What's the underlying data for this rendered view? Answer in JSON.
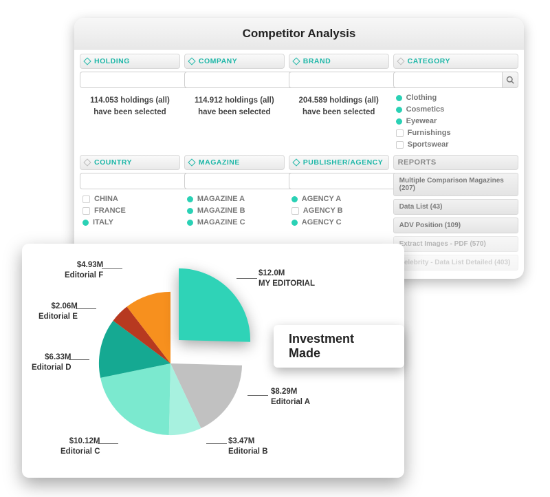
{
  "panel": {
    "title": "Competitor Analysis",
    "filters": {
      "holding": {
        "label": "HOLDING",
        "status_line1": "114.053 holdings (all)",
        "status_line2": "have been selected"
      },
      "company": {
        "label": "COMPANY",
        "status_line1": "114.912 holdings (all)",
        "status_line2": "have been selected"
      },
      "brand": {
        "label": "BRAND",
        "status_line1": "204.589 holdings (all)",
        "status_line2": "have been selected"
      },
      "category": {
        "label": "CATEGORY"
      },
      "country": {
        "label": "COUNTRY"
      },
      "magazine": {
        "label": "MAGAZINE"
      },
      "publisher": {
        "label": "PUBLISHER/AGENCY"
      },
      "reports": {
        "label": "REPORTS"
      }
    },
    "category_items": [
      {
        "label": "Clothing",
        "selected": true
      },
      {
        "label": "Cosmetics",
        "selected": true
      },
      {
        "label": "Eyewear",
        "selected": true
      },
      {
        "label": "Furnishings",
        "selected": false
      },
      {
        "label": "Sportswear",
        "selected": false
      }
    ],
    "country_items": [
      {
        "label": "CHINA",
        "selected": false
      },
      {
        "label": "FRANCE",
        "selected": false
      },
      {
        "label": "ITALY",
        "selected": true
      }
    ],
    "magazine_items": [
      {
        "label": "MAGAZINE A",
        "selected": true
      },
      {
        "label": "MAGAZINE B",
        "selected": true
      },
      {
        "label": "MAGAZINE C",
        "selected": true
      }
    ],
    "publisher_items": [
      {
        "label": "AGENCY A",
        "selected": true
      },
      {
        "label": "AGENCY B",
        "selected": false
      },
      {
        "label": "AGENCY C",
        "selected": true
      }
    ],
    "reports": [
      {
        "label": "Multiple Comparison Magazines (207)"
      },
      {
        "label": "Data List (43)"
      },
      {
        "label": "ADV Position (109)"
      },
      {
        "label": "Extract Images - PDF (570)"
      },
      {
        "label": "Celebrity - Data List Detailed (403)"
      }
    ]
  },
  "card": {
    "chip": "Investment Made"
  },
  "chart_data": {
    "type": "pie",
    "title": "Investment Made",
    "series": [
      {
        "name": "MY EDITORIAL",
        "value": 12.0,
        "label": "$12.0M",
        "color": "#2fd3b7",
        "raised": true
      },
      {
        "name": "Editorial A",
        "value": 8.29,
        "label": "$8.29M",
        "color": "#c1c1c1"
      },
      {
        "name": "Editorial B",
        "value": 3.47,
        "label": "$3.47M",
        "color": "#a7f1df"
      },
      {
        "name": "Editorial C",
        "value": 10.12,
        "label": "$10.12M",
        "color": "#7be9cf"
      },
      {
        "name": "Editorial D",
        "value": 6.33,
        "label": "$6.33M",
        "color": "#15a992"
      },
      {
        "name": "Editorial E",
        "value": 2.06,
        "label": "$2.06M",
        "color": "#b73920"
      },
      {
        "name": "Editorial F",
        "value": 4.93,
        "label": "$4.93M",
        "color": "#f7901e"
      }
    ]
  }
}
